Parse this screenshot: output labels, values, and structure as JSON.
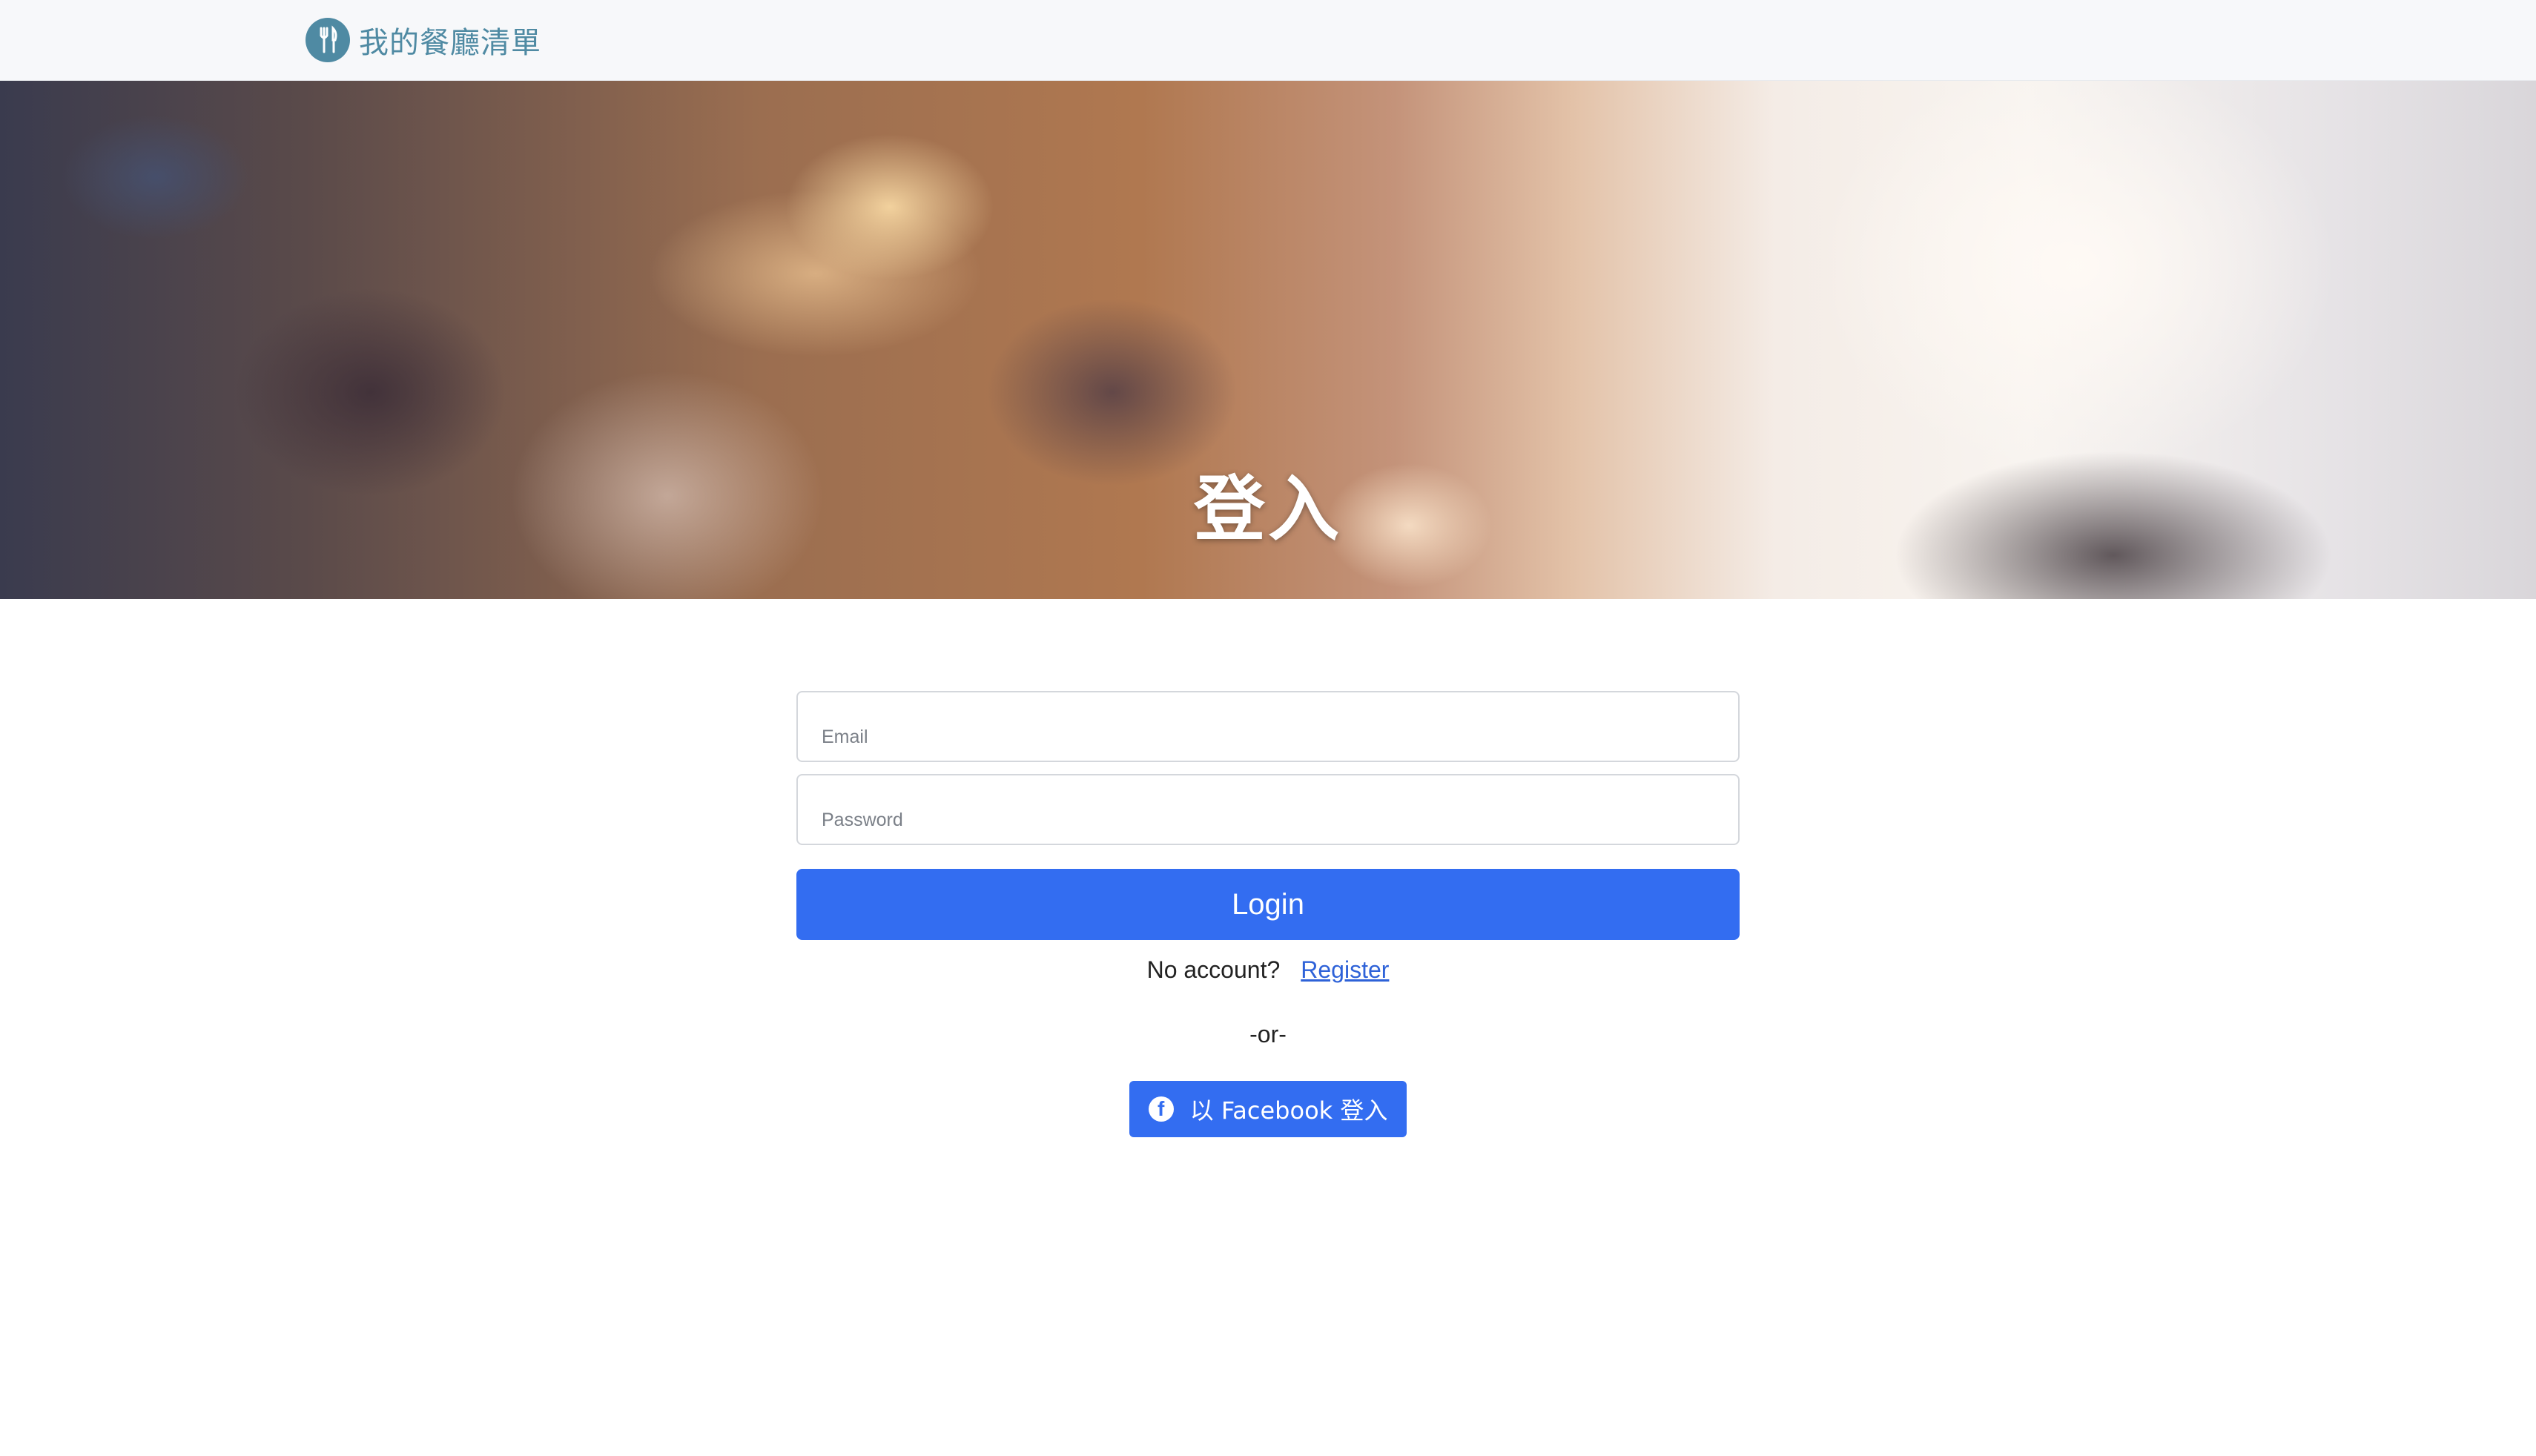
{
  "navbar": {
    "brand_text": "我的餐廳清單",
    "brand_icon": "utensils-icon",
    "brand_color": "#4f8aa3"
  },
  "hero": {
    "title": "登入"
  },
  "form": {
    "email_placeholder": "Email",
    "password_placeholder": "Password",
    "login_label": "Login",
    "no_account_text": "No account?",
    "register_label": "Register",
    "or_text": "-or-",
    "facebook_label": "以 Facebook 登入",
    "facebook_icon": "facebook-icon",
    "primary_color": "#336df1"
  }
}
